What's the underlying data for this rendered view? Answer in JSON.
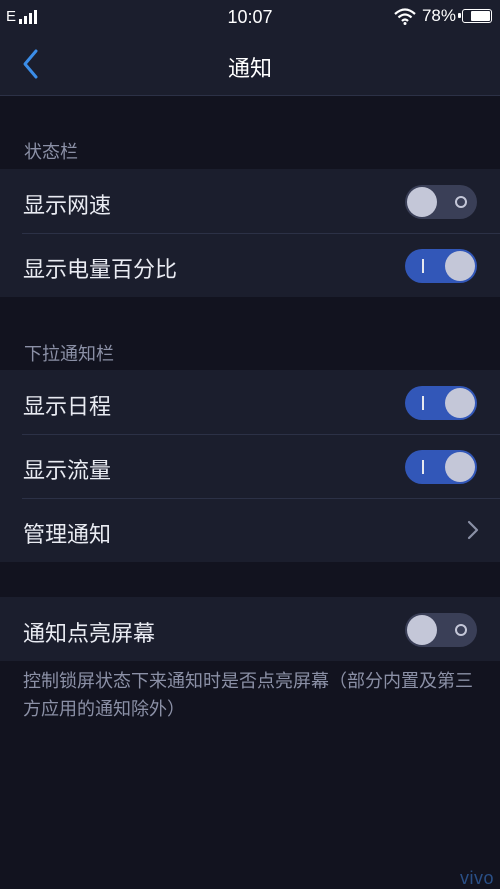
{
  "status_bar": {
    "network_type": "E",
    "time": "10:07",
    "battery_text": "78%",
    "battery_level": 0.78,
    "icons": [
      "signal-icon",
      "wifi-icon",
      "battery-icon"
    ]
  },
  "nav": {
    "title": "通知",
    "back_icon": "chevron-left-icon"
  },
  "sections": {
    "status_bar": {
      "header": "状态栏",
      "items": [
        {
          "label": "显示网速",
          "toggle": "off"
        },
        {
          "label": "显示电量百分比",
          "toggle": "on"
        }
      ]
    },
    "pulldown": {
      "header": "下拉通知栏",
      "items": [
        {
          "label": "显示日程",
          "toggle": "on"
        },
        {
          "label": "显示流量",
          "toggle": "on"
        },
        {
          "label": "管理通知",
          "icon": "chevron-right-icon"
        }
      ]
    },
    "wake": {
      "items": [
        {
          "label": "通知点亮屏幕",
          "toggle": "off"
        }
      ],
      "description": "控制锁屏状态下来通知时是否点亮屏幕（部分内置及第三方应用的通知除外）"
    }
  },
  "brand": "vivo",
  "colors": {
    "background": "#12131f",
    "panel": "#1b1e2d",
    "toggle_on": "#3257b8",
    "toggle_off": "#3a3f57",
    "accent_back": "#3b8de8",
    "secondary_text": "#8b90a6"
  }
}
